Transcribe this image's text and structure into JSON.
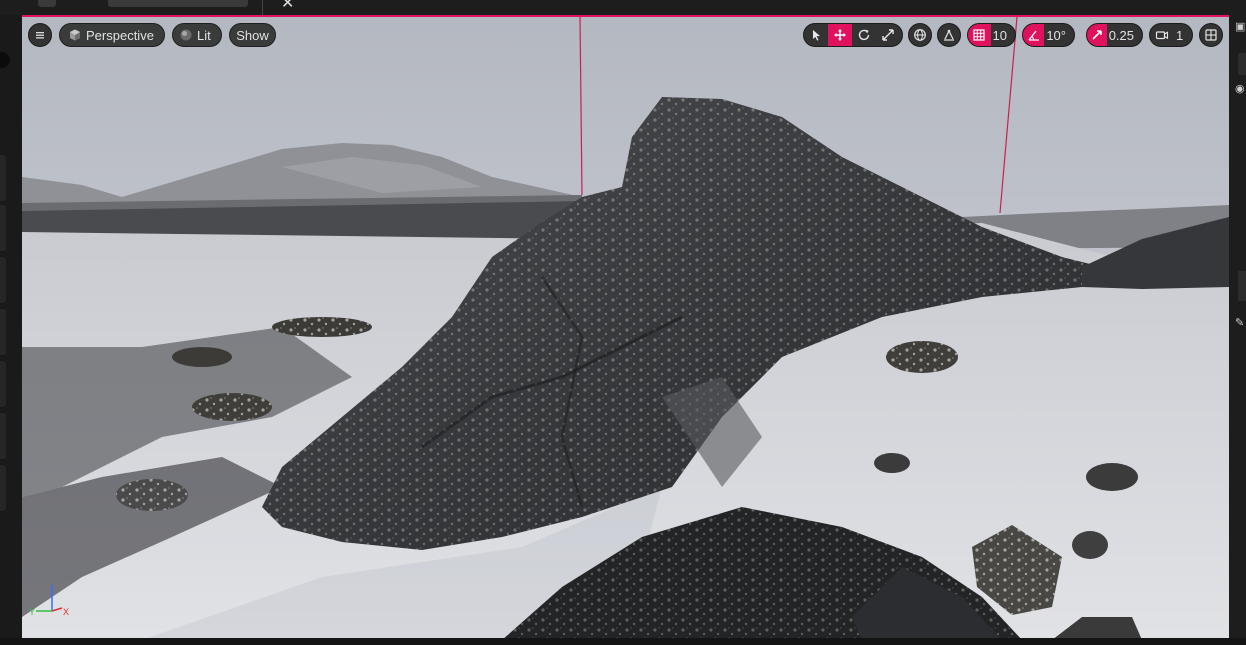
{
  "viewport": {
    "menu_icon": "hamburger-icon",
    "view_mode_label": "Perspective",
    "lighting_label": "Lit",
    "show_label": "Show"
  },
  "toolbar": {
    "tools": [
      "select-arrow-icon",
      "translate-icon",
      "rotate-icon",
      "scale-icon"
    ],
    "active_tool": "translate-icon",
    "grid_snap_value": "10",
    "rotation_snap_value": "10°",
    "scale_snap_value": "0.25",
    "camera_speed_value": "1"
  },
  "colors": {
    "accent": "#e0125f",
    "chip_bg": "#2f2f2f",
    "panel_bg": "#1a1a1a"
  },
  "axis_gizmo": {
    "y_label": "Y",
    "x_label": "X"
  }
}
